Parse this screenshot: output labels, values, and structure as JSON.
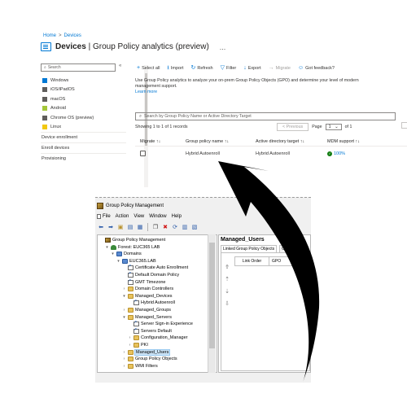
{
  "portal": {
    "breadcrumb": [
      "Home",
      "Devices"
    ],
    "breadcrumb_sep": ">",
    "title_bold": "Devices",
    "title_rest": " | Group Policy analytics (preview)",
    "title_menu": "...",
    "search_placeholder": "Search",
    "collapse": "«",
    "nav_items": [
      {
        "label": "Windows",
        "icon": "windows-icon",
        "color": "#0078d4"
      },
      {
        "label": "iOS/iPadOS",
        "icon": "phone-icon",
        "color": "#605e5c"
      },
      {
        "label": "macOS",
        "icon": "mac-icon",
        "color": "#605e5c"
      },
      {
        "label": "Android",
        "icon": "android-icon",
        "color": "#a4c639"
      },
      {
        "label": "Chrome OS (preview)",
        "icon": "chrome-icon",
        "color": "#605e5c"
      },
      {
        "label": "Linux",
        "icon": "linux-icon",
        "color": "#f2c811"
      }
    ],
    "sections": [
      {
        "label": "Device enrollment"
      },
      {
        "label": "Enroll devices"
      },
      {
        "label": "Provisioning"
      }
    ],
    "toolbar": [
      {
        "glyph": "+",
        "label": "Select all",
        "enabled": true
      },
      {
        "glyph": "⭳",
        "label": "Import",
        "enabled": true
      },
      {
        "glyph": "↻",
        "label": "Refresh",
        "enabled": true
      },
      {
        "glyph": "▽",
        "label": "Filter",
        "enabled": true
      },
      {
        "glyph": "↓",
        "label": "Export",
        "enabled": true
      },
      {
        "glyph": "→",
        "label": "Migrate",
        "enabled": false
      },
      {
        "glyph": "☺",
        "label": "Got feedback?",
        "enabled": true
      }
    ],
    "description": "Use Group Policy analytics to analyze your on-prem Group Policy Objects (GPO) and determine your level of modern management support.",
    "learn_more": "Learn more",
    "filter_placeholder": "Search by Group Policy Name or Active Directory Target",
    "showing": "Showing 1 to 1 of 1 records",
    "pager": {
      "previous": "< Previous",
      "page_label": "Page",
      "page_value": "1",
      "of": "of 1"
    },
    "columns": [
      "Migrate ↑↓",
      "Group policy name ↑↓",
      "Active directory target ↑↓",
      "MDM support ↑↓"
    ],
    "rows": [
      {
        "policy_name": "Hybrid Autoenroll",
        "target": "Hybrid Autoenroll",
        "mdm_support": "100%"
      }
    ],
    "accent_color": "#0078d4",
    "ok_color": "#107c10"
  },
  "gpmc": {
    "title": "Group Policy Management",
    "menu": [
      "File",
      "Action",
      "View",
      "Window",
      "Help"
    ],
    "tree": [
      {
        "label": "Group Policy Management",
        "depth": 0,
        "twisty": "",
        "icon": "gpmicon"
      },
      {
        "label": "Forest: EUC365 LAB",
        "depth": 1,
        "twisty": "▾",
        "icon": "forest"
      },
      {
        "label": "Domains",
        "depth": 2,
        "twisty": "▾",
        "icon": "domain"
      },
      {
        "label": "EUC365.LAB",
        "depth": 3,
        "twisty": "▾",
        "icon": "domain"
      },
      {
        "label": "Certificate Auto Enrollment",
        "depth": 4,
        "twisty": "",
        "icon": "link"
      },
      {
        "label": "Default Domain Policy",
        "depth": 4,
        "twisty": "",
        "icon": "link"
      },
      {
        "label": "GMT Timezone",
        "depth": 4,
        "twisty": "",
        "icon": "link"
      },
      {
        "label": "Domain Controllers",
        "depth": 4,
        "twisty": "›",
        "icon": "folder"
      },
      {
        "label": "Managed_Devices",
        "depth": 4,
        "twisty": "▾",
        "icon": "folder"
      },
      {
        "label": "Hybrid Autoenroll",
        "depth": 5,
        "twisty": "",
        "icon": "link"
      },
      {
        "label": "Managed_Groups",
        "depth": 4,
        "twisty": "›",
        "icon": "folder"
      },
      {
        "label": "Managed_Servers",
        "depth": 4,
        "twisty": "▾",
        "icon": "folder"
      },
      {
        "label": "Server Sign-in Experience",
        "depth": 5,
        "twisty": "",
        "icon": "link"
      },
      {
        "label": "Servers Default",
        "depth": 5,
        "twisty": "",
        "icon": "link"
      },
      {
        "label": "Configuration_Manager",
        "depth": 5,
        "twisty": "›",
        "icon": "folder"
      },
      {
        "label": "PKI",
        "depth": 5,
        "twisty": "›",
        "icon": "folder"
      },
      {
        "label": "Managed_Users",
        "depth": 4,
        "twisty": "›",
        "icon": "folder",
        "selected": true
      },
      {
        "label": "Group Policy Objects",
        "depth": 4,
        "twisty": "›",
        "icon": "folder"
      },
      {
        "label": "WMI Filters",
        "depth": 4,
        "twisty": "›",
        "icon": "folder"
      }
    ],
    "detail_title": "Managed_Users",
    "tabs": [
      "Linked Group Policy Objects",
      "Group Po"
    ],
    "grid_columns": [
      "Link Order",
      "GPO"
    ],
    "side_buttons": [
      "⇮",
      "⇡",
      "⇣",
      "⇩"
    ]
  }
}
